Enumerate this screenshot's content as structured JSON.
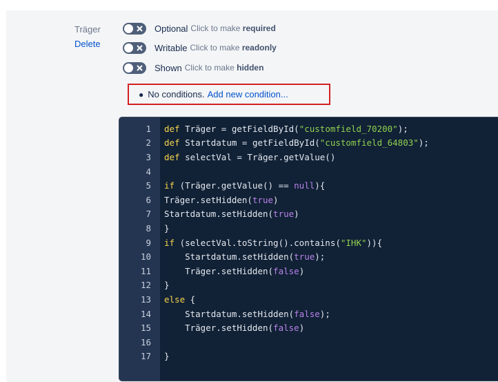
{
  "field": {
    "label": "Träger",
    "delete": "Delete"
  },
  "toggles": [
    {
      "name": "Optional",
      "hint": "Click to make ",
      "hint_bold": "required"
    },
    {
      "name": "Writable",
      "hint": "Click to make ",
      "hint_bold": "readonly"
    },
    {
      "name": "Shown",
      "hint": "Click to make ",
      "hint_bold": "hidden"
    }
  ],
  "conditions": {
    "text": "No conditions.",
    "link": "Add new condition..."
  },
  "editor": {
    "line_numbers": [
      "1",
      "2",
      "3",
      "4",
      "5",
      "6",
      "7",
      "8",
      "9",
      "10",
      "11",
      "12",
      "13",
      "14",
      "15",
      "16",
      "17"
    ],
    "lines": [
      [
        [
          "kw",
          "def "
        ],
        [
          "",
          "Träger = getFieldById("
        ],
        [
          "str",
          "\"customfield_70200\""
        ],
        [
          "",
          ");"
        ]
      ],
      [
        [
          "kw",
          "def "
        ],
        [
          "",
          "Startdatum = getFieldById("
        ],
        [
          "str",
          "\"customfield_64803\""
        ],
        [
          "",
          ");"
        ]
      ],
      [
        [
          "kw",
          "def "
        ],
        [
          "",
          "selectVal = Träger.getValue()"
        ]
      ],
      [],
      [
        [
          "kw",
          "if "
        ],
        [
          "",
          "(Träger.getValue() == "
        ],
        [
          "lit",
          "null"
        ],
        [
          "",
          "){"
        ]
      ],
      [
        [
          "",
          "Träger.setHidden("
        ],
        [
          "lit",
          "true"
        ],
        [
          "",
          ")"
        ]
      ],
      [
        [
          "",
          "Startdatum.setHidden("
        ],
        [
          "lit",
          "true"
        ],
        [
          "",
          ")"
        ]
      ],
      [
        [
          "",
          "}"
        ]
      ],
      [
        [
          "kw",
          "if "
        ],
        [
          "",
          "(selectVal.toString().contains("
        ],
        [
          "str",
          "\"IHK\""
        ],
        [
          "",
          "))"
        ],
        [
          "",
          "{"
        ]
      ],
      [
        [
          "",
          "    Startdatum.setHidden("
        ],
        [
          "lit",
          "true"
        ],
        [
          "",
          ");"
        ]
      ],
      [
        [
          "",
          "    Träger.setHidden("
        ],
        [
          "lit",
          "false"
        ],
        [
          "",
          ")"
        ]
      ],
      [
        [
          "",
          "}"
        ]
      ],
      [
        [
          "kw",
          "else "
        ],
        [
          "",
          "{"
        ]
      ],
      [
        [
          "",
          "    Startdatum.setHidden("
        ],
        [
          "lit",
          "false"
        ],
        [
          "",
          ");"
        ]
      ],
      [
        [
          "",
          "    Träger.setHidden("
        ],
        [
          "lit",
          "false"
        ],
        [
          "",
          ")"
        ]
      ],
      [],
      [
        [
          "",
          "}"
        ]
      ]
    ]
  }
}
